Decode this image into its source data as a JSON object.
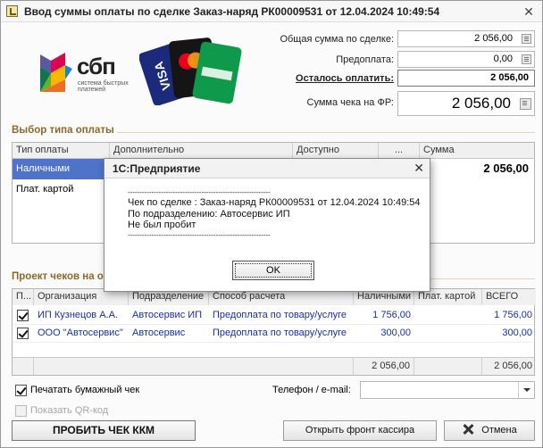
{
  "window": {
    "title": "Ввод суммы оплаты по сделке Заказ-наряд РК00009531 от 12.04.2024 10:49:54",
    "close_glyph": "✕"
  },
  "logos": {
    "sbp_word": "сбп",
    "sbp_subtitle": "система быстрых платежей"
  },
  "summary": {
    "total_label": "Общая сумма по сделке:",
    "total_value": "2 056,00",
    "prepay_label": "Предоплата:",
    "prepay_value": "0,00",
    "remain_label": "Осталось оплатить:",
    "remain_value": "2 056,00",
    "fr_label": "Сумма чека на ФР:",
    "fr_value": "2 056,00"
  },
  "payment_section": {
    "title": "Выбор типа оплаты",
    "columns": [
      "Тип оплаты",
      "Дополнительно",
      "Доступно",
      "...",
      "Сумма"
    ],
    "rows": [
      {
        "type": "Наличными",
        "sum": "2 056,00"
      },
      {
        "type": "Плат. картой",
        "sum": ""
      }
    ]
  },
  "receipts_section": {
    "title": "Проект чеков на о",
    "columns": [
      "П...",
      "Организация",
      "Подразделение",
      "Способ расчета",
      "Наличными",
      "Плат. картой",
      "ВСЕГО"
    ],
    "rows": [
      {
        "org": "ИП Кузнецов А.А.",
        "dept": "Автосервис ИП",
        "method": "Предоплата по товару/услуге",
        "cash": "1 756,00",
        "card": "",
        "total": "1 756,00"
      },
      {
        "org": "ООО \"Автосервис\"",
        "dept": "Автосервис",
        "method": "Предоплата по товару/услуге",
        "cash": "300,00",
        "card": "",
        "total": "300,00"
      }
    ],
    "footer": {
      "cash": "2 056,00",
      "card": "",
      "total": "2 056,00"
    }
  },
  "options": {
    "print_paper": "Печатать бумажный чек",
    "show_qr": "Показать QR-код",
    "phone_label": "Телефон / e-mail:",
    "phone_value": ""
  },
  "buttons": {
    "punch": "ПРОБИТЬ ЧЕК ККМ",
    "open_front": "Открыть фронт кассира",
    "cancel": "Отмена"
  },
  "modal": {
    "title": "1С:Предприятие",
    "close_glyph": "✕",
    "lines": [
      "------------------------------------------------------------",
      "Чек по сделке : Заказ-наряд РК00009531 от 12.04.2024 10:49:54",
      "По подразделению: Автосервис ИП",
      "Не был пробит",
      "------------------------------------------------------------"
    ],
    "ok": "OK"
  }
}
